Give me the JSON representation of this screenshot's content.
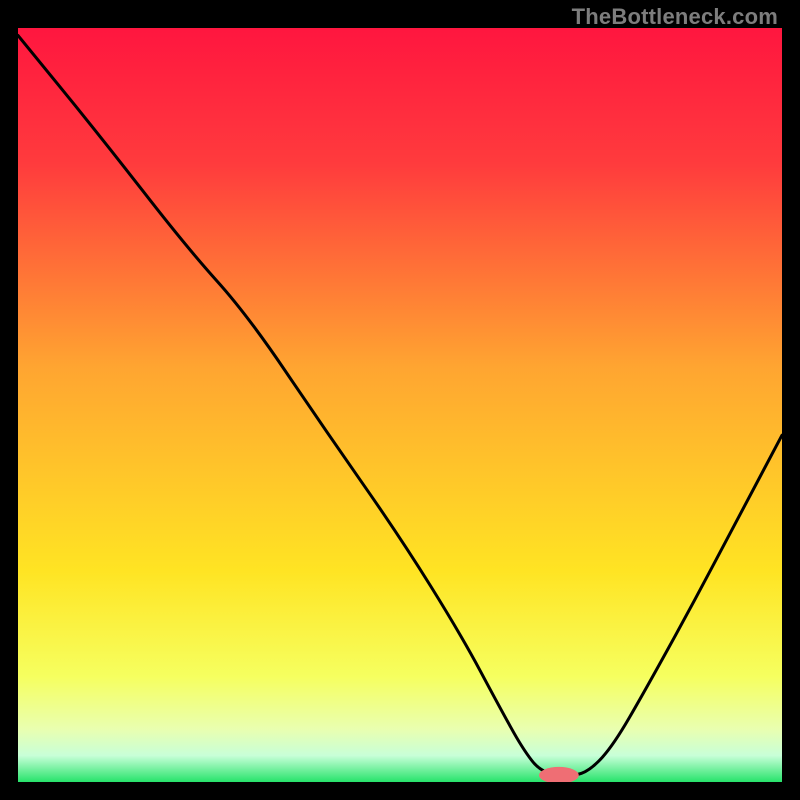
{
  "watermark": "TheBottleneck.com",
  "chart_data": {
    "type": "line",
    "title": "",
    "xlabel": "",
    "ylabel": "",
    "xlim": [
      0,
      100
    ],
    "ylim": [
      0,
      100
    ],
    "grid": false,
    "legend": false,
    "gradient_stops": [
      {
        "offset": 0.0,
        "color": "#ff163f"
      },
      {
        "offset": 0.18,
        "color": "#ff3b3d"
      },
      {
        "offset": 0.45,
        "color": "#ffa531"
      },
      {
        "offset": 0.72,
        "color": "#ffe423"
      },
      {
        "offset": 0.86,
        "color": "#f6ff5f"
      },
      {
        "offset": 0.93,
        "color": "#e9ffb0"
      },
      {
        "offset": 0.965,
        "color": "#c8ffd8"
      },
      {
        "offset": 1.0,
        "color": "#27e36b"
      }
    ],
    "series": [
      {
        "name": "bottleneck-curve",
        "x": [
          0.0,
          10.5,
          22.0,
          30.0,
          40.0,
          50.0,
          58.0,
          63.0,
          66.0,
          68.5,
          72.5,
          75.0,
          78.0,
          82.0,
          88.0,
          94.0,
          100.0
        ],
        "y": [
          99.0,
          86.0,
          71.0,
          62.0,
          47.0,
          32.5,
          19.5,
          10.0,
          4.5,
          1.2,
          0.7,
          1.6,
          5.0,
          12.0,
          23.0,
          34.5,
          46.0
        ]
      }
    ],
    "marker": {
      "name": "optimal-point",
      "x": 70.8,
      "y": 0.9,
      "color": "#ef6e74",
      "rx": 2.6,
      "ry": 1.1
    }
  }
}
